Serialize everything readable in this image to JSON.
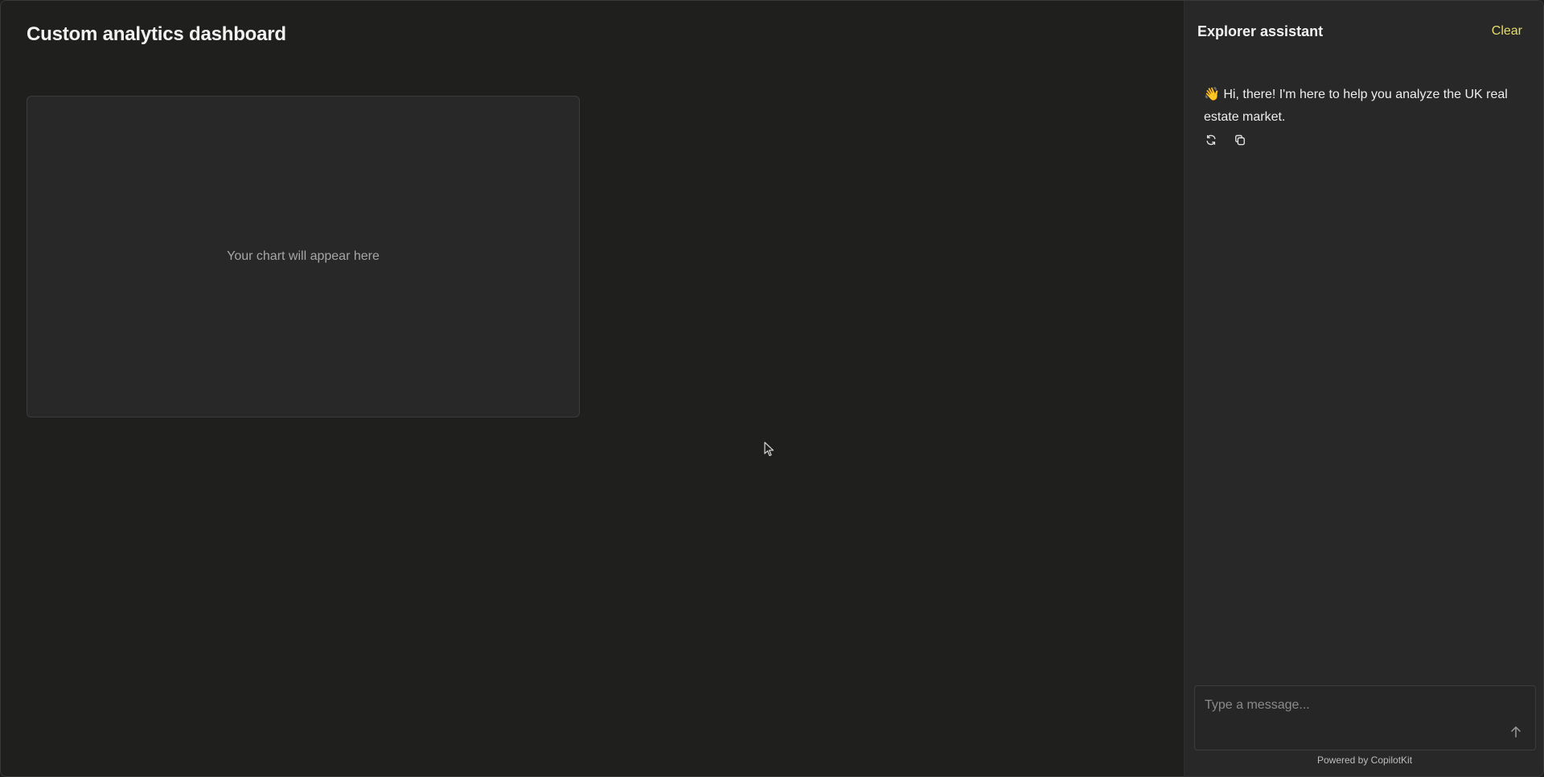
{
  "dashboard": {
    "title": "Custom analytics dashboard",
    "chart_placeholder": "Your chart will appear here"
  },
  "assistant": {
    "title": "Explorer assistant",
    "clear_label": "Clear",
    "greeting_emoji": "👋",
    "greeting_text": "Hi, there! I'm here to help you analyze the UK real estate market.",
    "actions": [
      "regenerate-icon",
      "copy-icon"
    ],
    "composer": {
      "value": "",
      "placeholder": "Type a message..."
    },
    "powered_by": "Powered by CopilotKit"
  },
  "colors": {
    "background": "#1f1f1e",
    "sidebar": "#282828",
    "accent": "#e6dc6a"
  }
}
